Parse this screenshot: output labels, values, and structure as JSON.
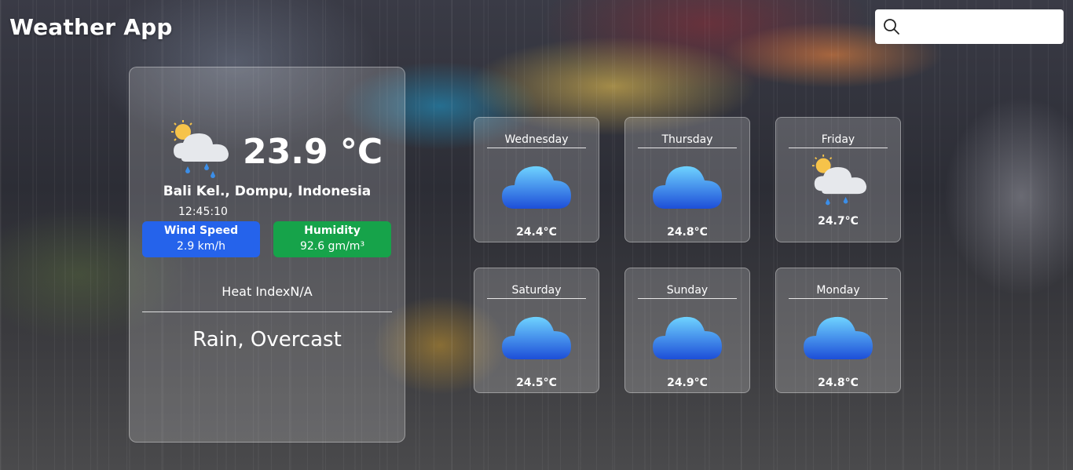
{
  "app": {
    "title": "Weather App"
  },
  "search": {
    "placeholder": ""
  },
  "current": {
    "temperature": "23.9 °C",
    "icon": "sun-cloud-rain-icon",
    "location": "Bali Kel., Dompu, Indonesia",
    "time": "12:45:10",
    "wind": {
      "label": "Wind Speed",
      "value": "2.9 km/h",
      "color": "#2563eb"
    },
    "humidity": {
      "label": "Humidity",
      "value": "92.6 gm/m³",
      "color": "#16a34a"
    },
    "heat_index": "Heat IndexN/A",
    "condition": "Rain, Overcast"
  },
  "forecast": [
    {
      "day": "Wednesday",
      "temp": "24.4°C",
      "icon": "cloud-icon"
    },
    {
      "day": "Thursday",
      "temp": "24.8°C",
      "icon": "cloud-icon"
    },
    {
      "day": "Friday",
      "temp": "24.7°C",
      "icon": "sun-cloud-rain-icon"
    },
    {
      "day": "Saturday",
      "temp": "24.5°C",
      "icon": "cloud-icon"
    },
    {
      "day": "Sunday",
      "temp": "24.9°C",
      "icon": "cloud-icon"
    },
    {
      "day": "Monday",
      "temp": "24.8°C",
      "icon": "cloud-icon"
    }
  ]
}
